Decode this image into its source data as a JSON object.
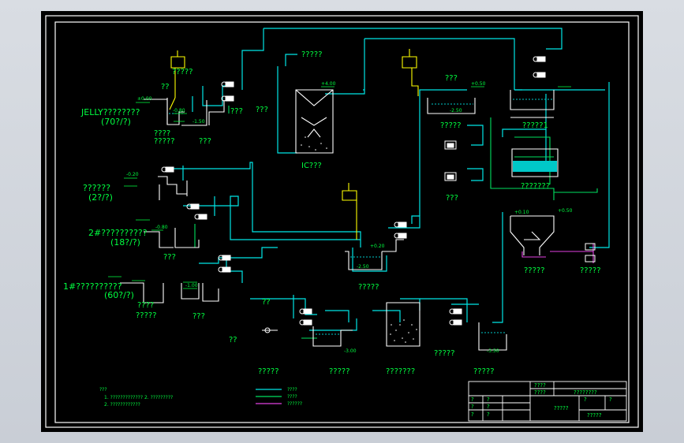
{
  "drawing": {
    "labels": {
      "jelly_pit": "JELLY????????",
      "jelly_temp": "(70?/?)",
      "pit_a": "??????",
      "pit_a_temp": "(2?/?)",
      "pit_b": "2#??????????",
      "pit_b_temp": "(18?/?)",
      "pit_c": "1#??????????",
      "pit_c_temp": "(60?/?)",
      "ic_top": "?????",
      "ic_name": "IC???",
      "tank_1a": "????",
      "tank_1b": "?????",
      "tank_2": "???",
      "tank_3": "???",
      "tank_4": "????",
      "tank_4b": "?????",
      "tank_5": "???",
      "tank_6": "?????",
      "tank_7": "?????1",
      "tank_8": "???????",
      "tank_9": "?????",
      "tank_10": "?????",
      "tank_11": "?????",
      "tank_12": "?????",
      "tank_13": "???????",
      "tank_14": "?????",
      "tank_15": "?????",
      "tank_16": "???",
      "tank_17": "???",
      "tank_18": "???",
      "tank_19": "????",
      "tank_20": "?????",
      "inlet_a": "??",
      "inlet_b": "??",
      "dosing_label": "?????",
      "small_a": "??",
      "small_b": "???"
    },
    "levels": {
      "l1": "±0.00",
      "l2": "-0.80",
      "l3": "-1.50",
      "l4": "+4.00",
      "l5": "+0.50",
      "l6": "-2.50",
      "l7": "-0.20",
      "l8": "-0.80",
      "l9": "-1.00",
      "l10": "+0.20",
      "l11": "-2.50",
      "l12": "-3.00",
      "l13": "+0.50",
      "l14": "-3.50",
      "l15": "+0.10"
    },
    "notes": {
      "title": "???",
      "line1": "1. ?????????????  2. ?????????",
      "line2": "2. ????????????"
    },
    "legend": [
      {
        "label": "????",
        "color": "#00e5e5"
      },
      {
        "label": "????",
        "color": "#00e060"
      },
      {
        "label": "??????",
        "color": "#e040e0"
      }
    ],
    "title_block": {
      "r1c1": "????",
      "r2c1": "????",
      "r2c2": "????????",
      "name": "?????",
      "q": "?",
      "sheet": "?????"
    },
    "colors": {
      "sewage": "#00e5e5",
      "sludge": "#00e060",
      "gas": "#e040e0",
      "frame": "#ffffff",
      "text": "#00ff40",
      "yellow": "#ffff00"
    }
  }
}
